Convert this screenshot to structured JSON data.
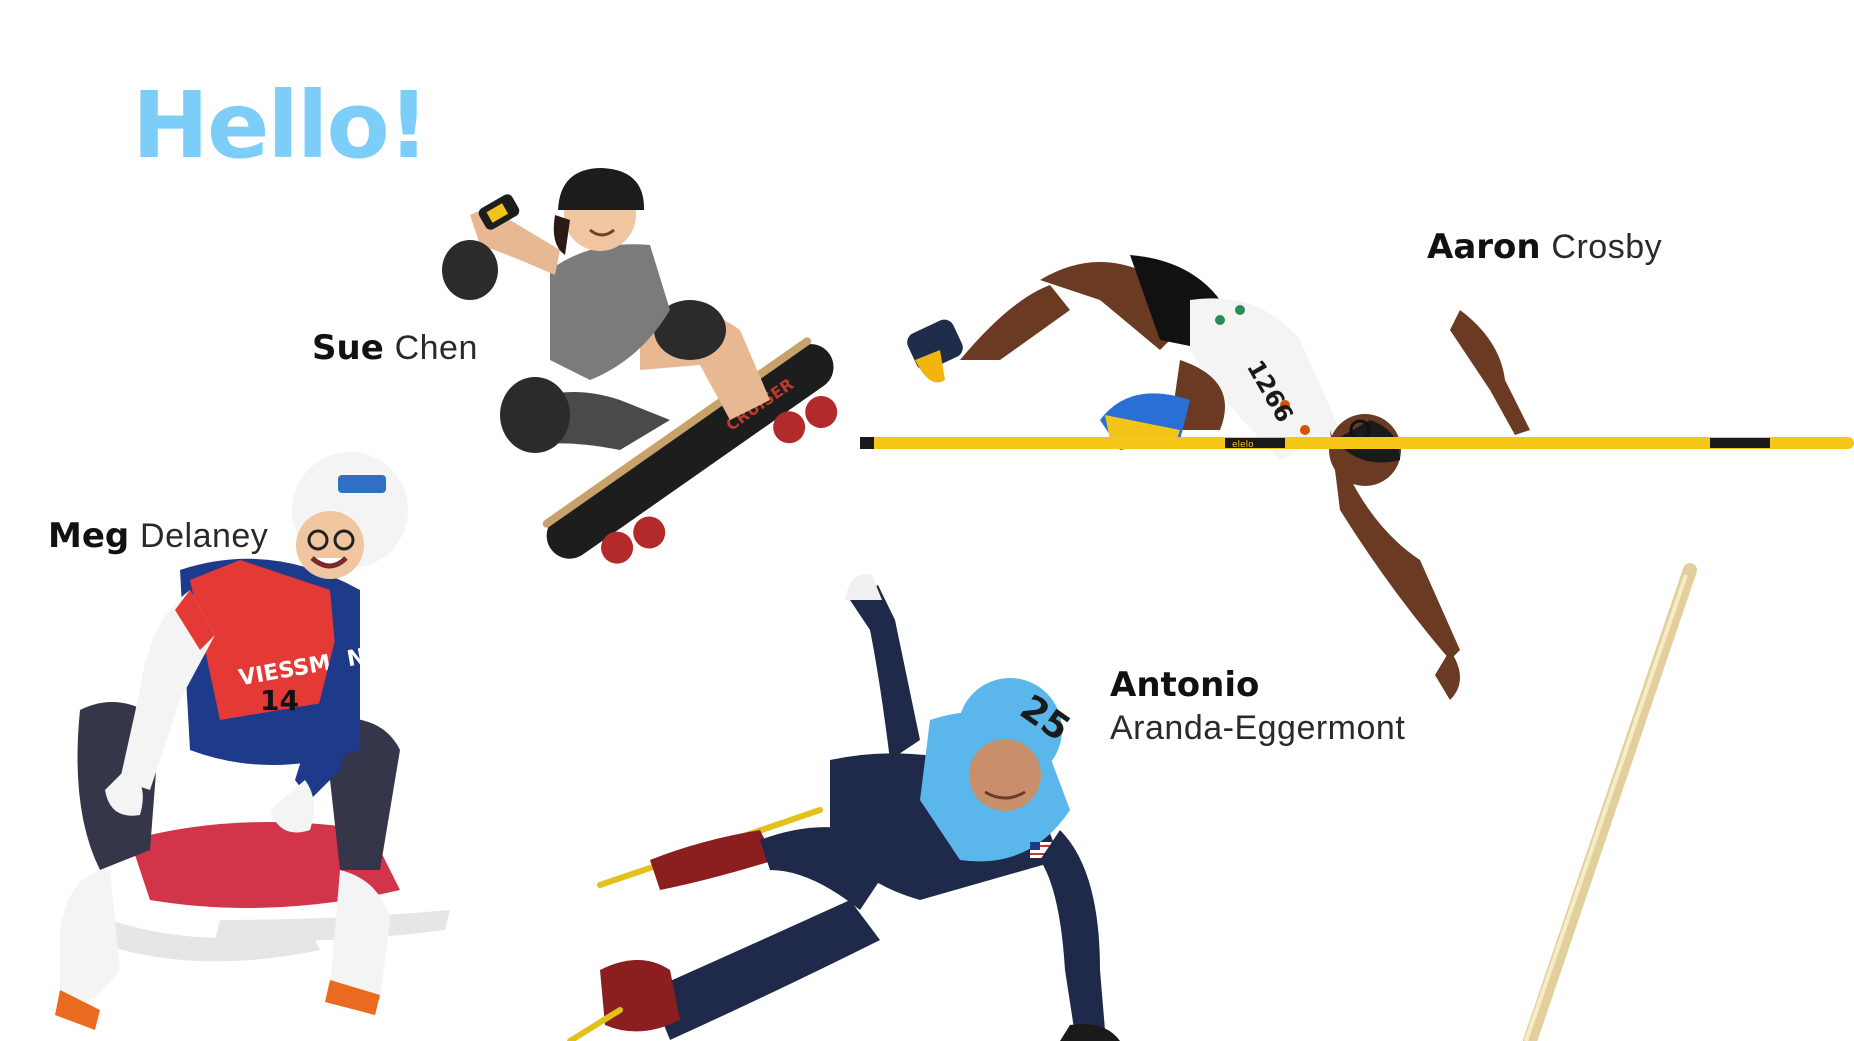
{
  "slide": {
    "title": "Hello!",
    "accent_color": "#7ccdf7"
  },
  "people": {
    "sue": {
      "first": "Sue",
      "last": "Chen",
      "sport_icon": "skateboarder-icon"
    },
    "aaron": {
      "first": "Aaron",
      "last": "Crosby",
      "sport_icon": "high-jumper-icon"
    },
    "meg": {
      "first": "Meg",
      "last": "Delaney",
      "sport_icon": "luge-athlete-icon"
    },
    "antonio": {
      "first": "Antonio",
      "last": "Aranda-Eggermont",
      "sport_icon": "speed-skater-icon"
    }
  },
  "photo_text": {
    "sue_board": "CRUISER",
    "aaron_bib": "1266",
    "meg_bib": "14",
    "meg_sponsor": "VIESSMANN",
    "antonio_helmet": "25",
    "bar_brand": "elelo"
  }
}
